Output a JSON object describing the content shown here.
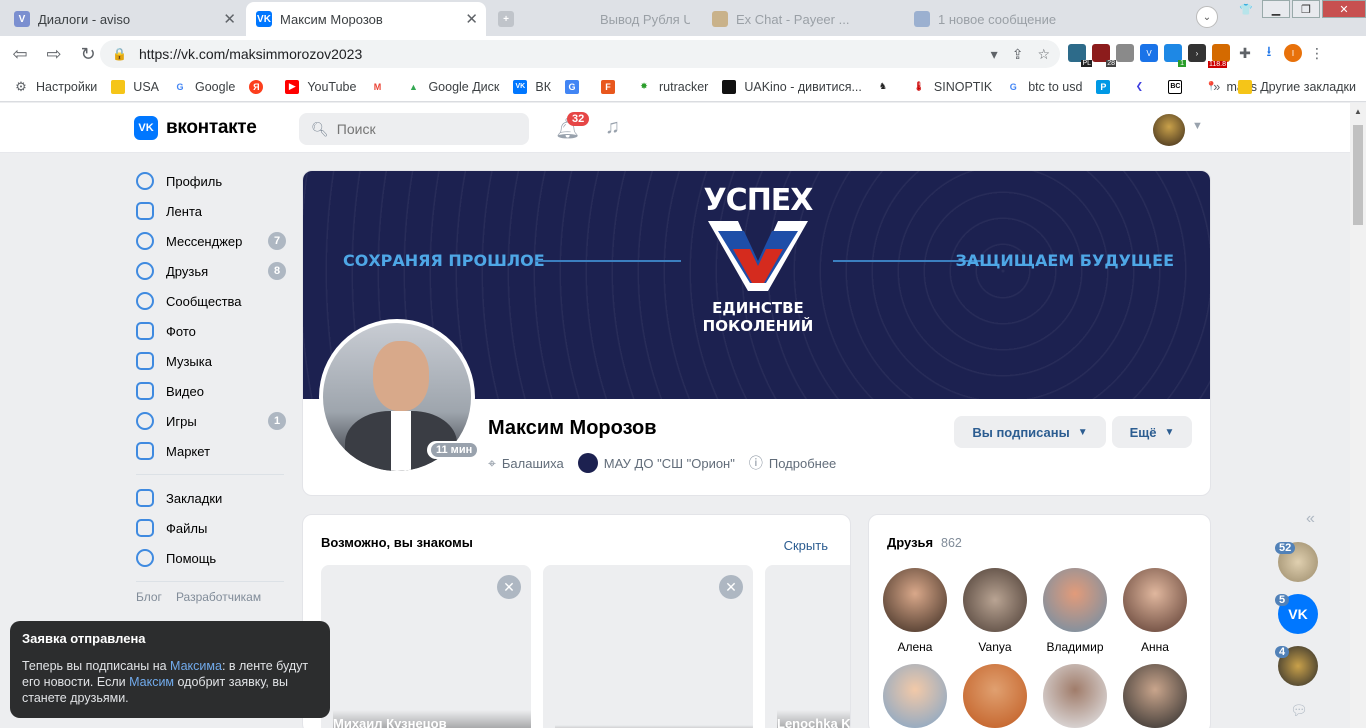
{
  "browser": {
    "tabs": [
      {
        "title": "Диалоги - aviso",
        "active": false
      },
      {
        "title": "Максим Морозов",
        "active": true
      },
      {
        "title": "",
        "active": false
      },
      {
        "title": "Вывод Рубля USD на карту...",
        "active": false
      },
      {
        "title": "Ex Chat - Payeer ...",
        "active": false
      },
      {
        "title": "1 новое сообщение",
        "active": false
      }
    ],
    "url": "https://vk.com/maksimmorozov2023",
    "bookmarks": [
      "Настройки",
      "USA",
      "Google",
      "Я",
      "YouTube",
      "Gmail",
      "Google Диск",
      "ВК",
      "Translate",
      "F",
      "rutracker",
      "UAKino - дивитися...",
      "SINOPTIK",
      "btc to usd",
      "P",
      "BC",
      "maps"
    ],
    "bookmarks_other": "Другие закладки",
    "ext_badges": {
      "pl": "PL",
      "n28": "28",
      "one": "1",
      "price": "118.8"
    }
  },
  "vk": {
    "logo_text": "вконтакте",
    "search_placeholder": "Поиск",
    "notif_count": "32",
    "menu": [
      {
        "label": "Профиль",
        "count": ""
      },
      {
        "label": "Лента",
        "count": ""
      },
      {
        "label": "Мессенджер",
        "count": "7"
      },
      {
        "label": "Друзья",
        "count": "8"
      },
      {
        "label": "Сообщества",
        "count": ""
      },
      {
        "label": "Фото",
        "count": ""
      },
      {
        "label": "Музыка",
        "count": ""
      },
      {
        "label": "Видео",
        "count": ""
      },
      {
        "label": "Игры",
        "count": "1"
      },
      {
        "label": "Маркет",
        "count": ""
      }
    ],
    "menu2": [
      {
        "label": "Закладки"
      },
      {
        "label": "Файлы"
      },
      {
        "label": "Помощь"
      }
    ],
    "menu_links": [
      "Блог",
      "Разработчикам"
    ],
    "cover": {
      "title": "УСПЕХ",
      "sub1": "ЕДИНСТВЕ",
      "sub2": "ПОКОЛЕНИЙ",
      "left": "СОХРАНЯЯ ПРОШЛОЕ",
      "right": "ЗАЩИЩАЕМ БУДУЩЕЕ"
    },
    "profile": {
      "name": "Максим Морозов",
      "online": "11 мин",
      "city": "Балашиха",
      "org": "МАУ ДО \"СШ \"Орион\"",
      "more": "Подробнее",
      "subscribed_btn": "Вы подписаны",
      "more_btn": "Ещё"
    },
    "pymk": {
      "title": "Возможно, вы знакомы",
      "hide": "Скрыть",
      "people": [
        "Михаил Кузнецов",
        "",
        "Lenochka K"
      ]
    },
    "friends": {
      "title": "Друзья",
      "count": "862",
      "list": [
        "Алена",
        "Vanya",
        "Владимир",
        "Анна",
        "",
        "",
        "",
        ""
      ]
    },
    "side_counts": [
      "52",
      "5",
      "4"
    ],
    "toast": {
      "title": "Заявка отправлена",
      "p1": "Теперь вы подписаны на ",
      "name1": "Максима",
      "p2": ": в ленте будут его новости. Если ",
      "name2": "Максим",
      "p3": " одобрит заявку, вы станете друзьями."
    }
  }
}
